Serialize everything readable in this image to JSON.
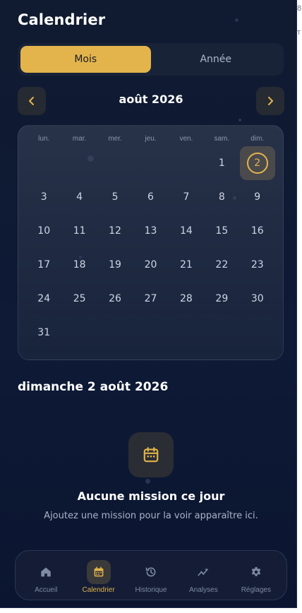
{
  "screen": {
    "title": "Calendrier"
  },
  "view_toggle": {
    "month_label": "Mois",
    "year_label": "Année",
    "selected": "Mois"
  },
  "calendar": {
    "month_title": "août 2026",
    "weekdays": [
      "lun.",
      "mar.",
      "mer.",
      "jeu.",
      "ven.",
      "sam.",
      "dim."
    ],
    "weeks": [
      [
        "",
        "",
        "",
        "",
        "",
        "1",
        "2"
      ],
      [
        "3",
        "4",
        "5",
        "6",
        "7",
        "8",
        "9"
      ],
      [
        "10",
        "11",
        "12",
        "13",
        "14",
        "15",
        "16"
      ],
      [
        "17",
        "18",
        "19",
        "20",
        "21",
        "22",
        "23"
      ],
      [
        "24",
        "25",
        "26",
        "27",
        "28",
        "29",
        "30"
      ],
      [
        "31",
        "",
        "",
        "",
        "",
        "",
        ""
      ]
    ],
    "selected_day": "2"
  },
  "day_detail": {
    "heading": "dimanche 2 août 2026",
    "empty_title": "Aucune mission ce jour",
    "empty_subtitle": "Ajoutez une mission pour la voir apparaître ici."
  },
  "tabbar": {
    "items": [
      {
        "label": "Accueil",
        "icon": "home-icon",
        "active": false
      },
      {
        "label": "Calendrier",
        "icon": "calendar-icon",
        "active": true
      },
      {
        "label": "Historique",
        "icon": "history-icon",
        "active": false
      },
      {
        "label": "Analyses",
        "icon": "analytics-icon",
        "active": false
      },
      {
        "label": "Réglages",
        "icon": "gear-icon",
        "active": false
      }
    ]
  },
  "colors": {
    "accent": "#e3b44c",
    "background": "#0e1a36"
  }
}
